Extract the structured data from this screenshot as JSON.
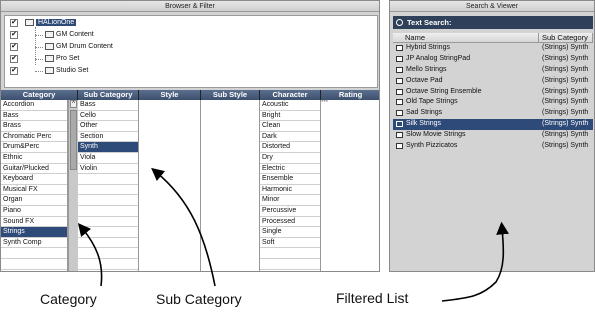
{
  "left_panel": {
    "title": "Browser & Filter"
  },
  "tree": {
    "root": "HALionOne",
    "children": [
      "GM Content",
      "GM Drum Content",
      "Pro Set",
      "Studio Set"
    ]
  },
  "columns": [
    {
      "header": "Category"
    },
    {
      "header": "Sub Category"
    },
    {
      "header": "Style"
    },
    {
      "header": "Sub Style"
    },
    {
      "header": "Character"
    },
    {
      "header": "Rating"
    }
  ],
  "categories": [
    "Accordion",
    "Bass",
    "Brass",
    "Chromatic Perc",
    "Drum&Perc",
    "Ethnic",
    "Guitar/Plucked",
    "Keyboard",
    "Musical FX",
    "Organ",
    "Piano",
    "Sound FX",
    "Strings",
    "Synth Comp"
  ],
  "categories_selected": 12,
  "subcategories": [
    "Bass",
    "Cello",
    "Other",
    "Section",
    "Synth",
    "Viola",
    "Violin"
  ],
  "subcategories_selected": 4,
  "characters": [
    "Acoustic",
    "Bright",
    "Clean",
    "Dark",
    "Distorted",
    "Dry",
    "Electric",
    "Ensemble",
    "Harmonic",
    "Minor",
    "Percussive",
    "Processed",
    "Single",
    "Soft"
  ],
  "rating_stars": "***",
  "right_panel": {
    "title": "Search & Viewer",
    "search_label": "Text Search:",
    "col_name": "Name",
    "col_sub": "Sub Category"
  },
  "results": [
    {
      "name": "Hybrid Strings",
      "sub": "(Strings) Synth"
    },
    {
      "name": "JP Analog StringPad",
      "sub": "(Strings) Synth"
    },
    {
      "name": "Mello Strings",
      "sub": "(Strings) Synth"
    },
    {
      "name": "Octave Pad",
      "sub": "(Strings) Synth"
    },
    {
      "name": "Octave String Ensemble",
      "sub": "(Strings) Synth"
    },
    {
      "name": "Old Tape Strings",
      "sub": "(Strings) Synth"
    },
    {
      "name": "Sad Strings",
      "sub": "(Strings) Synth"
    },
    {
      "name": "Silk Strings",
      "sub": "(Strings) Synth"
    },
    {
      "name": "Slow Movie Strings",
      "sub": "(Strings) Synth"
    },
    {
      "name": "Synth Pizzicatos",
      "sub": "(Strings) Synth"
    }
  ],
  "results_selected": 7,
  "captions": {
    "category": "Category",
    "subcategory": "Sub Category",
    "filtered": "Filtered List"
  }
}
